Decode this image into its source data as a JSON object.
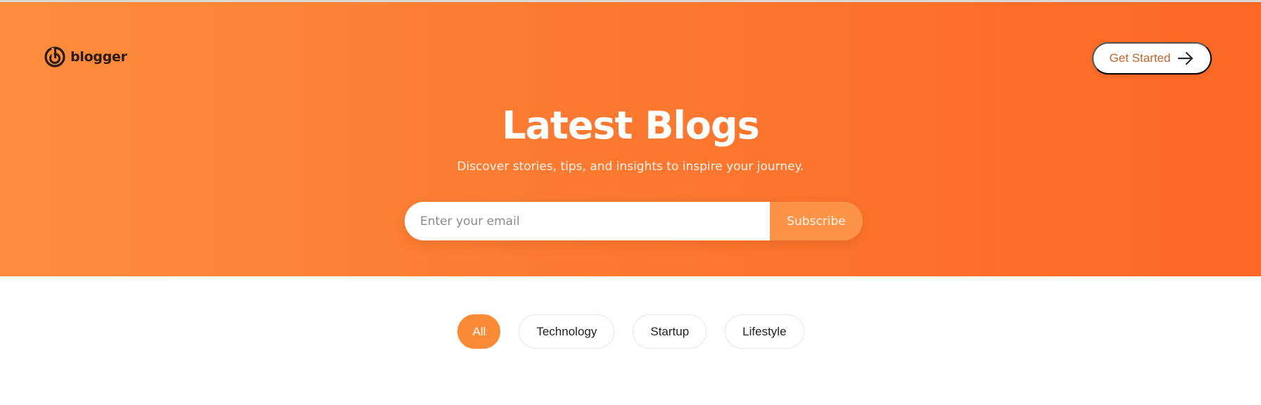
{
  "brand": {
    "name": "blogger",
    "logo_icon": "spiral-logo-icon"
  },
  "header": {
    "cta_label": "Get Started",
    "cta_icon": "arrow-right-icon"
  },
  "hero": {
    "title": "Latest Blogs",
    "subtitle": "Discover stories, tips, and insights to inspire your journey.",
    "email_placeholder": "Enter your email",
    "subscribe_label": "Subscribe"
  },
  "filters": {
    "selected": "All",
    "items": [
      {
        "label": "All"
      },
      {
        "label": "Technology"
      },
      {
        "label": "Startup"
      },
      {
        "label": "Lifestyle"
      }
    ]
  },
  "colors": {
    "hero_gradient_start": "#fd8d3d",
    "hero_gradient_end": "#fd6826",
    "accent": "#fb8a37",
    "cta_text": "#c0642c"
  }
}
